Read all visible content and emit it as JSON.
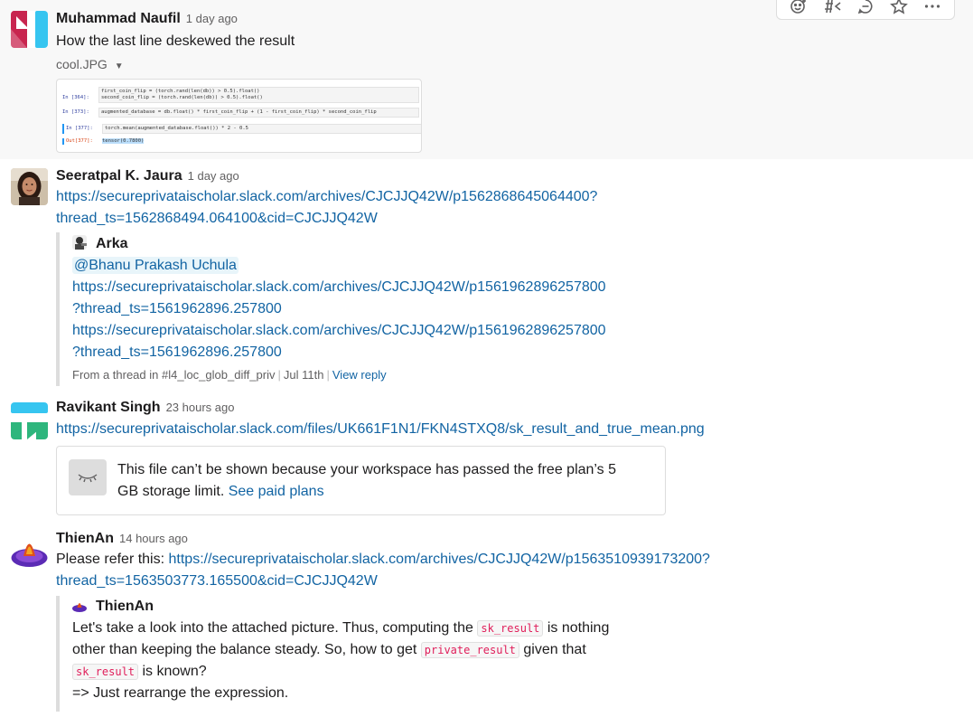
{
  "toolbar": {
    "icons": [
      "add-reaction-icon",
      "share-to-channel-icon",
      "reply-in-thread-icon",
      "save-star-icon",
      "more-actions-icon"
    ]
  },
  "messages": [
    {
      "author": "Muhammad Naufil",
      "timestamp": "1 day ago",
      "text": "How the last line deskewed the result",
      "file": {
        "name": "cool.JPG",
        "code_lines": [
          {
            "prompt": "In [364]:",
            "code": "first_coin_flip = (torch.rand(len(db)) > 0.5).float()"
          },
          {
            "prompt": "",
            "code": "second_coin_flip = (torch.rand(len(db)) > 0.5).float()"
          },
          {
            "prompt": "In [373]:",
            "code": "augmented_database = db.float() * first_coin_flip + (1 - first_coin_flip) * second_coin_flip"
          },
          {
            "prompt": "In [377]:",
            "code": "torch.mean(augmented_database.float()) * 2 - 0.5"
          },
          {
            "prompt": "Out[377]:",
            "code": "tensor(0.7800)"
          }
        ]
      }
    },
    {
      "author": "Seeratpal K. Jaura",
      "timestamp": "1 day ago",
      "link_line1": "https://secureprivataischolar.slack.com/archives/CJCJJQ42W/p1562868645064400?",
      "link_line2": "thread_ts=1562868494.064100&cid=CJCJJQ42W",
      "quote": {
        "author": "Arka",
        "mention": "@Bhanu Prakash Uchula",
        "lines": [
          "https://secureprivataischolar.slack.com/archives/CJCJJQ42W/p1561962896257800",
          "?thread_ts=1561962896.257800",
          "https://secureprivataischolar.slack.com/archives/CJCJJQ42W/p1561962896257800",
          "?thread_ts=1561962896.257800"
        ],
        "footer_source": "From a thread in #l4_loc_glob_diff_priv",
        "footer_date": "Jul 11th",
        "footer_action": "View reply"
      }
    },
    {
      "author": "Ravikant Singh",
      "timestamp": "23 hours ago",
      "link": "https://secureprivataischolar.slack.com/files/UK661F1N1/FKN4STXQ8/sk_result_and_true_mean.png",
      "notice_line1": "This file can’t be shown because your workspace has passed the free plan’s 5",
      "notice_line2": "GB storage limit.",
      "notice_link": "See paid plans"
    },
    {
      "author": "ThienAn",
      "timestamp": "14 hours ago",
      "text_prefix": "Please refer this:",
      "link_line1": "https://secureprivataischolar.slack.com/archives/CJCJJQ42W/p1563510939173200?",
      "link_line2": "thread_ts=1563503773.165500&cid=CJCJJQ42W",
      "quote": {
        "author": "ThienAn",
        "l1a": "Let's take a look into the attached picture. Thus, computing the",
        "code1": "sk_result",
        "l1b": "is nothing",
        "l2a": "other than keeping the balance steady. So, how to get",
        "code2": "private_result",
        "l2b": "given that",
        "code3": "sk_result",
        "l3b": "is known?",
        "l4": "=> Just rearrange the expression."
      }
    }
  ]
}
